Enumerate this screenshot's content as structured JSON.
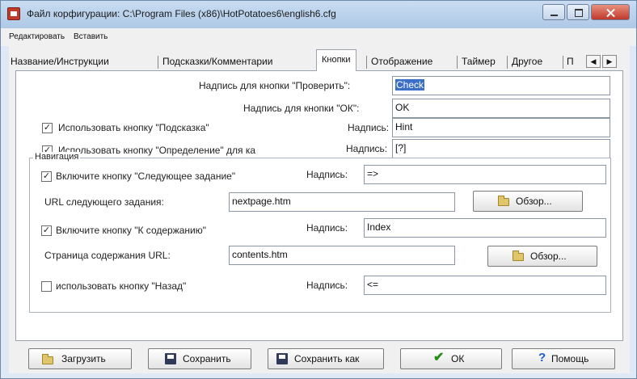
{
  "window": {
    "title": "Файл корфигурации: C:\\Program Files (x86)\\HotPotatoes6\\english6.cfg"
  },
  "menu": {
    "edit": "Редактировать",
    "insert": "Вставить"
  },
  "tabs": [
    {
      "label": "Название/Инструкции"
    },
    {
      "label": "Подсказки/Комментарии"
    },
    {
      "label": "Кнопки"
    },
    {
      "label": "Отображение"
    },
    {
      "label": "Таймер"
    },
    {
      "label": "Другое"
    },
    {
      "label": "П"
    }
  ],
  "buttons_tab": {
    "check_caption_label": "Надпись для кнопки \"Проверить\":",
    "check_caption_value": "Check",
    "ok_caption_label": "Надпись для кнопки \"ОК\":",
    "ok_caption_value": "OK",
    "hint_checkbox_label": "Использовать кнопку \"Подсказка\"",
    "hint_checked": true,
    "hint_caption_label": "Надпись:",
    "hint_caption_value": "Hint",
    "definition_checkbox_label": "Использовать кнопку \"Определение\" для ка",
    "definition_checked": true,
    "definition_caption_label": "Надпись:",
    "definition_caption_value": "[?]",
    "navigation": {
      "title": "Навигация",
      "next_checkbox_label": "Включите кнопку \"Следующее задание\"",
      "next_checked": true,
      "next_caption_label": "Надпись:",
      "next_caption_value": "=>",
      "next_url_label": "URL следующего задания:",
      "next_url_value": "nextpage.htm",
      "browse_label": "Обзор...",
      "contents_checkbox_label": "Включите кнопку \"К содержанию\"",
      "contents_checked": true,
      "contents_caption_label": "Надпись:",
      "contents_caption_value": "Index",
      "contents_url_label": "Страница содержания URL:",
      "contents_url_value": "contents.htm",
      "back_checkbox_label": "использовать кнопку \"Назад\"",
      "back_checked": false,
      "back_caption_label": "Надпись:",
      "back_caption_value": "<="
    }
  },
  "footer": {
    "load": "Загрузить",
    "save": "Сохранить",
    "save_as": "Сохранить как",
    "ok": "ОК",
    "help": "Помощь"
  },
  "colors": {
    "selection": "#3c6fc8",
    "close_button": "#c0392b",
    "titlebar": "#aec8e6"
  }
}
